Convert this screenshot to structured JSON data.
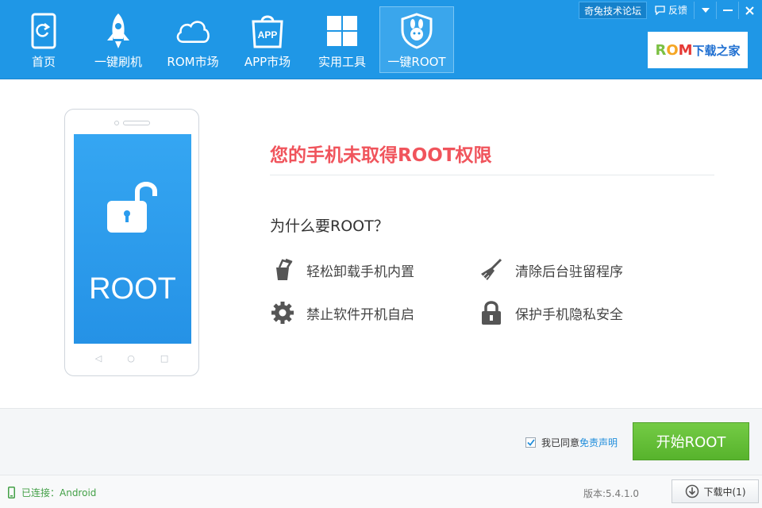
{
  "header": {
    "nav": [
      {
        "label": "首页",
        "icon": "home-icon"
      },
      {
        "label": "一键刷机",
        "icon": "rocket-icon"
      },
      {
        "label": "ROM市场",
        "icon": "cloud-icon"
      },
      {
        "label": "APP市场",
        "icon": "app-bag-icon",
        "icon_text": "APP"
      },
      {
        "label": "实用工具",
        "icon": "grid-tools-icon"
      },
      {
        "label": "一键ROOT",
        "icon": "root-shield-icon",
        "active": true
      }
    ],
    "forum_label": "奇兔技术论坛",
    "feedback_label": "反馈",
    "brand": {
      "part1": "R",
      "part2": "O",
      "part3": "M",
      "suffix": "下载之家"
    }
  },
  "phone": {
    "screen_text": "ROOT"
  },
  "main": {
    "status_title": "您的手机未取得ROOT权限",
    "why_title": "为什么要ROOT？",
    "features": [
      {
        "label": "轻松卸载手机内置",
        "icon": "uninstall-icon"
      },
      {
        "label": "清除后台驻留程序",
        "icon": "broom-icon"
      },
      {
        "label": "禁止软件开机自启",
        "icon": "gear-icon"
      },
      {
        "label": "保护手机隐私安全",
        "icon": "lock-icon"
      }
    ]
  },
  "action": {
    "agree_checked": true,
    "agree_text": "我已同意",
    "agree_link": "免责声明",
    "start_label": "开始ROOT"
  },
  "status": {
    "connection": "已连接：Android",
    "version": "版本:5.4.1.0",
    "download_label": "下载中(1)"
  },
  "colors": {
    "header_bg": "#1f97e6",
    "title_red": "#f0545c",
    "button_green": "#5dbb30",
    "connected_green": "#43a047",
    "link_blue": "#1f8ddb"
  }
}
